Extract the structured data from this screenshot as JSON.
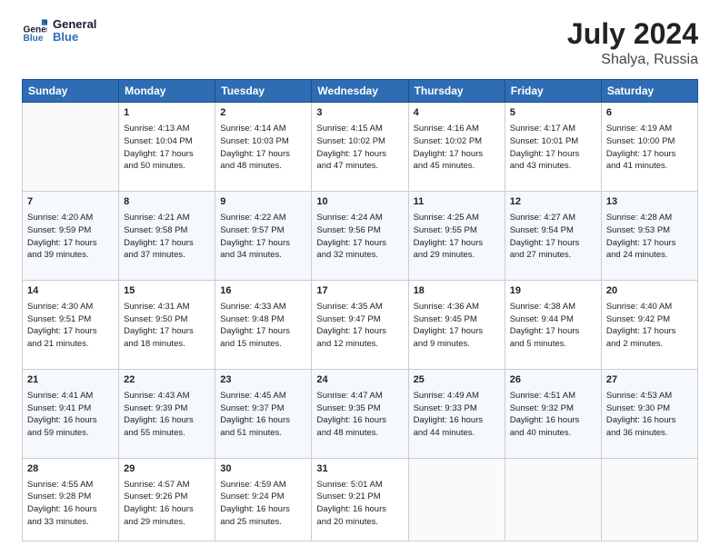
{
  "header": {
    "logo_general": "General",
    "logo_blue": "Blue",
    "month_year": "July 2024",
    "location": "Shalya, Russia"
  },
  "columns": [
    "Sunday",
    "Monday",
    "Tuesday",
    "Wednesday",
    "Thursday",
    "Friday",
    "Saturday"
  ],
  "weeks": [
    [
      {
        "day": "",
        "content": ""
      },
      {
        "day": "1",
        "content": "Sunrise: 4:13 AM\nSunset: 10:04 PM\nDaylight: 17 hours\nand 50 minutes."
      },
      {
        "day": "2",
        "content": "Sunrise: 4:14 AM\nSunset: 10:03 PM\nDaylight: 17 hours\nand 48 minutes."
      },
      {
        "day": "3",
        "content": "Sunrise: 4:15 AM\nSunset: 10:02 PM\nDaylight: 17 hours\nand 47 minutes."
      },
      {
        "day": "4",
        "content": "Sunrise: 4:16 AM\nSunset: 10:02 PM\nDaylight: 17 hours\nand 45 minutes."
      },
      {
        "day": "5",
        "content": "Sunrise: 4:17 AM\nSunset: 10:01 PM\nDaylight: 17 hours\nand 43 minutes."
      },
      {
        "day": "6",
        "content": "Sunrise: 4:19 AM\nSunset: 10:00 PM\nDaylight: 17 hours\nand 41 minutes."
      }
    ],
    [
      {
        "day": "7",
        "content": "Sunrise: 4:20 AM\nSunset: 9:59 PM\nDaylight: 17 hours\nand 39 minutes."
      },
      {
        "day": "8",
        "content": "Sunrise: 4:21 AM\nSunset: 9:58 PM\nDaylight: 17 hours\nand 37 minutes."
      },
      {
        "day": "9",
        "content": "Sunrise: 4:22 AM\nSunset: 9:57 PM\nDaylight: 17 hours\nand 34 minutes."
      },
      {
        "day": "10",
        "content": "Sunrise: 4:24 AM\nSunset: 9:56 PM\nDaylight: 17 hours\nand 32 minutes."
      },
      {
        "day": "11",
        "content": "Sunrise: 4:25 AM\nSunset: 9:55 PM\nDaylight: 17 hours\nand 29 minutes."
      },
      {
        "day": "12",
        "content": "Sunrise: 4:27 AM\nSunset: 9:54 PM\nDaylight: 17 hours\nand 27 minutes."
      },
      {
        "day": "13",
        "content": "Sunrise: 4:28 AM\nSunset: 9:53 PM\nDaylight: 17 hours\nand 24 minutes."
      }
    ],
    [
      {
        "day": "14",
        "content": "Sunrise: 4:30 AM\nSunset: 9:51 PM\nDaylight: 17 hours\nand 21 minutes."
      },
      {
        "day": "15",
        "content": "Sunrise: 4:31 AM\nSunset: 9:50 PM\nDaylight: 17 hours\nand 18 minutes."
      },
      {
        "day": "16",
        "content": "Sunrise: 4:33 AM\nSunset: 9:48 PM\nDaylight: 17 hours\nand 15 minutes."
      },
      {
        "day": "17",
        "content": "Sunrise: 4:35 AM\nSunset: 9:47 PM\nDaylight: 17 hours\nand 12 minutes."
      },
      {
        "day": "18",
        "content": "Sunrise: 4:36 AM\nSunset: 9:45 PM\nDaylight: 17 hours\nand 9 minutes."
      },
      {
        "day": "19",
        "content": "Sunrise: 4:38 AM\nSunset: 9:44 PM\nDaylight: 17 hours\nand 5 minutes."
      },
      {
        "day": "20",
        "content": "Sunrise: 4:40 AM\nSunset: 9:42 PM\nDaylight: 17 hours\nand 2 minutes."
      }
    ],
    [
      {
        "day": "21",
        "content": "Sunrise: 4:41 AM\nSunset: 9:41 PM\nDaylight: 16 hours\nand 59 minutes."
      },
      {
        "day": "22",
        "content": "Sunrise: 4:43 AM\nSunset: 9:39 PM\nDaylight: 16 hours\nand 55 minutes."
      },
      {
        "day": "23",
        "content": "Sunrise: 4:45 AM\nSunset: 9:37 PM\nDaylight: 16 hours\nand 51 minutes."
      },
      {
        "day": "24",
        "content": "Sunrise: 4:47 AM\nSunset: 9:35 PM\nDaylight: 16 hours\nand 48 minutes."
      },
      {
        "day": "25",
        "content": "Sunrise: 4:49 AM\nSunset: 9:33 PM\nDaylight: 16 hours\nand 44 minutes."
      },
      {
        "day": "26",
        "content": "Sunrise: 4:51 AM\nSunset: 9:32 PM\nDaylight: 16 hours\nand 40 minutes."
      },
      {
        "day": "27",
        "content": "Sunrise: 4:53 AM\nSunset: 9:30 PM\nDaylight: 16 hours\nand 36 minutes."
      }
    ],
    [
      {
        "day": "28",
        "content": "Sunrise: 4:55 AM\nSunset: 9:28 PM\nDaylight: 16 hours\nand 33 minutes."
      },
      {
        "day": "29",
        "content": "Sunrise: 4:57 AM\nSunset: 9:26 PM\nDaylight: 16 hours\nand 29 minutes."
      },
      {
        "day": "30",
        "content": "Sunrise: 4:59 AM\nSunset: 9:24 PM\nDaylight: 16 hours\nand 25 minutes."
      },
      {
        "day": "31",
        "content": "Sunrise: 5:01 AM\nSunset: 9:21 PM\nDaylight: 16 hours\nand 20 minutes."
      },
      {
        "day": "",
        "content": ""
      },
      {
        "day": "",
        "content": ""
      },
      {
        "day": "",
        "content": ""
      }
    ]
  ]
}
